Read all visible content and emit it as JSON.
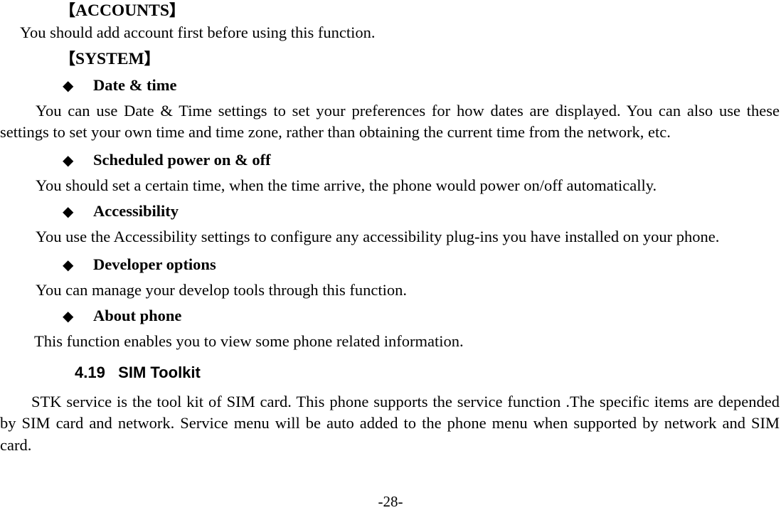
{
  "document": {
    "page_number_label": "-28-"
  },
  "blocks": {
    "accounts_heading": "【ACCOUNTS】",
    "accounts_heading_open": "【",
    "accounts_heading_text": "ACCOUNTS",
    "accounts_heading_close": "】",
    "accounts_body": "You should add account first before using this function.",
    "system_heading_open": "【",
    "system_heading_text": "SYSTEM",
    "system_heading_close": "】",
    "bullet_glyph": "◆",
    "date_time_heading": "Date & time",
    "date_time_body": "You can use Date & Time settings to set your preferences for how dates are displayed. You can also use these settings to set your own time and time zone, rather than obtaining the current time from the network, etc.",
    "scheduled_power_heading": "Scheduled power on & off",
    "scheduled_power_body": "You should set a certain time, when the time arrive, the phone would power on/off automatically.",
    "accessibility_heading": "Accessibility",
    "accessibility_body": "You use the Accessibility settings to configure any accessibility plug-ins you have installed on your phone.",
    "developer_options_heading": "Developer options",
    "developer_options_body": "You can manage your develop tools through this function.",
    "about_phone_heading": "About phone",
    "about_phone_body": "This function enables you to view some phone related information.",
    "sim_toolkit_section_number": "4.19",
    "sim_toolkit_section_title": "SIM Toolkit",
    "sim_toolkit_heading_full": "4.19   SIM Toolkit",
    "sim_toolkit_body": "STK service is the tool kit of SIM card. This phone supports the service function .The specific items are depended by SIM card and network. Service menu will be auto added to the phone menu when supported by network and SIM card."
  }
}
